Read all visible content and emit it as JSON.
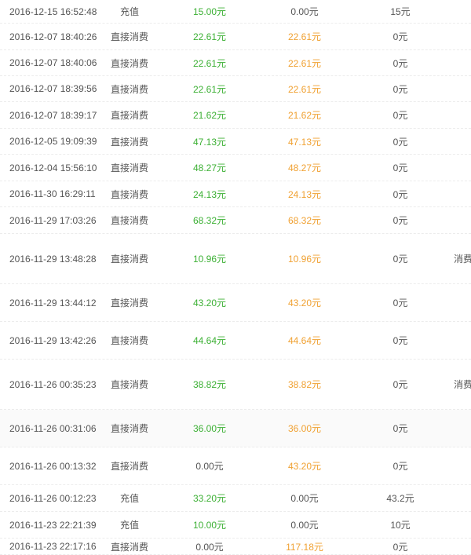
{
  "colors": {
    "green": "#3cb034",
    "orange": "#f0a132",
    "text": "#555555",
    "divider": "#ececec"
  },
  "records": [
    {
      "time": "2016-12-15 16:52:48",
      "type": "充值",
      "amount": "15.00元",
      "amount_color": "green",
      "paid": "0.00元",
      "paid_color": "gray",
      "balance": "15元",
      "note": ""
    },
    {
      "time": "2016-12-07 18:40:26",
      "type": "直接消费",
      "amount": "22.61元",
      "amount_color": "green",
      "paid": "22.61元",
      "paid_color": "orange",
      "balance": "0元",
      "note": ""
    },
    {
      "time": "2016-12-07 18:40:06",
      "type": "直接消费",
      "amount": "22.61元",
      "amount_color": "green",
      "paid": "22.61元",
      "paid_color": "orange",
      "balance": "0元",
      "note": ""
    },
    {
      "time": "2016-12-07 18:39:56",
      "type": "直接消费",
      "amount": "22.61元",
      "amount_color": "green",
      "paid": "22.61元",
      "paid_color": "orange",
      "balance": "0元",
      "note": ""
    },
    {
      "time": "2016-12-07 18:39:17",
      "type": "直接消费",
      "amount": "21.62元",
      "amount_color": "green",
      "paid": "21.62元",
      "paid_color": "orange",
      "balance": "0元",
      "note": ""
    },
    {
      "time": "2016-12-05 19:09:39",
      "type": "直接消费",
      "amount": "47.13元",
      "amount_color": "green",
      "paid": "47.13元",
      "paid_color": "orange",
      "balance": "0元",
      "note": ""
    },
    {
      "time": "2016-12-04 15:56:10",
      "type": "直接消费",
      "amount": "48.27元",
      "amount_color": "green",
      "paid": "48.27元",
      "paid_color": "orange",
      "balance": "0元",
      "note": ""
    },
    {
      "time": "2016-11-30 16:29:11",
      "type": "直接消费",
      "amount": "24.13元",
      "amount_color": "green",
      "paid": "24.13元",
      "paid_color": "orange",
      "balance": "0元",
      "note": ""
    },
    {
      "time": "2016-11-29 17:03:26",
      "type": "直接消费",
      "amount": "68.32元",
      "amount_color": "green",
      "paid": "68.32元",
      "paid_color": "orange",
      "balance": "0元",
      "note": ""
    },
    {
      "time": "2016-11-29 13:48:28",
      "type": "直接消费",
      "amount": "10.96元",
      "amount_color": "green",
      "paid": "10.96元",
      "paid_color": "orange",
      "balance": "0元",
      "note": "消费"
    },
    {
      "time": "2016-11-29 13:44:12",
      "type": "直接消费",
      "amount": "43.20元",
      "amount_color": "green",
      "paid": "43.20元",
      "paid_color": "orange",
      "balance": "0元",
      "note": ""
    },
    {
      "time": "2016-11-29 13:42:26",
      "type": "直接消费",
      "amount": "44.64元",
      "amount_color": "green",
      "paid": "44.64元",
      "paid_color": "orange",
      "balance": "0元",
      "note": ""
    },
    {
      "time": "2016-11-26 00:35:23",
      "type": "直接消费",
      "amount": "38.82元",
      "amount_color": "green",
      "paid": "38.82元",
      "paid_color": "orange",
      "balance": "0元",
      "note": "消费"
    },
    {
      "time": "2016-11-26 00:31:06",
      "type": "直接消费",
      "amount": "36.00元",
      "amount_color": "green",
      "paid": "36.00元",
      "paid_color": "orange",
      "balance": "0元",
      "note": ""
    },
    {
      "time": "2016-11-26 00:13:32",
      "type": "直接消费",
      "amount": "0.00元",
      "amount_color": "gray",
      "paid": "43.20元",
      "paid_color": "orange",
      "balance": "0元",
      "note": ""
    },
    {
      "time": "2016-11-26 00:12:23",
      "type": "充值",
      "amount": "33.20元",
      "amount_color": "green",
      "paid": "0.00元",
      "paid_color": "gray",
      "balance": "43.2元",
      "note": ""
    },
    {
      "time": "2016-11-23 22:21:39",
      "type": "充值",
      "amount": "10.00元",
      "amount_color": "green",
      "paid": "0.00元",
      "paid_color": "gray",
      "balance": "10元",
      "note": ""
    },
    {
      "time": "2016-11-23 22:17:16",
      "type": "直接消费",
      "amount": "0.00元",
      "amount_color": "gray",
      "paid": "117.18元",
      "paid_color": "orange",
      "balance": "0元",
      "note": ""
    }
  ]
}
